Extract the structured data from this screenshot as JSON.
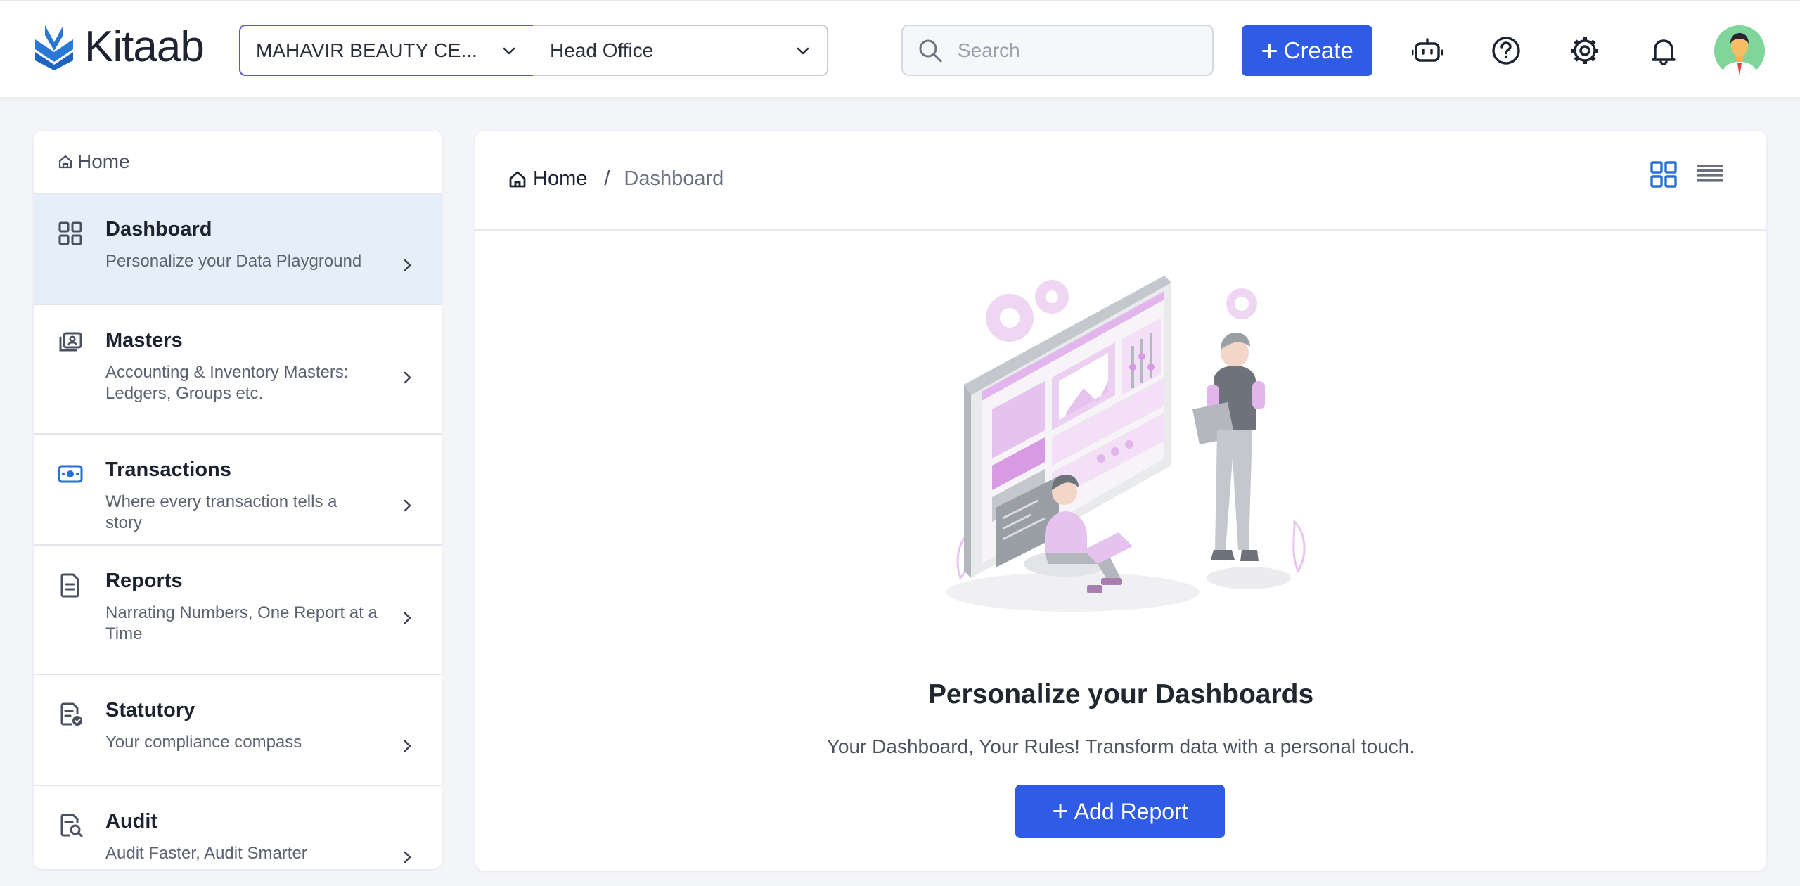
{
  "app": {
    "name": "Kitaab"
  },
  "header": {
    "company": "MAHAVIR BEAUTY CE...",
    "branch": "Head Office",
    "search_placeholder": "Search",
    "create_label": "Create",
    "icons": [
      "bot-icon",
      "help-icon",
      "gear-icon",
      "bell-icon"
    ]
  },
  "sidebar": {
    "home_label": "Home",
    "items": [
      {
        "title": "Dashboard",
        "desc": "Personalize your Data Playground",
        "icon": "grid-icon",
        "active": true
      },
      {
        "title": "Masters",
        "desc": "Accounting & Inventory Masters: Ledgers, Groups etc.",
        "icon": "masters-icon"
      },
      {
        "title": "Transactions",
        "desc": "Where every transaction tells a story",
        "icon": "transactions-icon"
      },
      {
        "title": "Reports",
        "desc": "Narrating Numbers, One Report at a Time",
        "icon": "report-icon"
      },
      {
        "title": "Statutory",
        "desc": "Your compliance compass",
        "icon": "statutory-icon"
      },
      {
        "title": "Audit",
        "desc": "Audit Faster, Audit Smarter",
        "icon": "audit-icon"
      }
    ]
  },
  "main": {
    "breadcrumb": {
      "home": "Home",
      "separator": "/",
      "current": "Dashboard"
    },
    "empty_state": {
      "title": "Personalize your Dashboards",
      "subtitle": "Your Dashboard, Your Rules! Transform data with a personal touch.",
      "button": "Add Report"
    }
  },
  "colors": {
    "primary": "#2f5be6",
    "active_bg": "#e6eef9",
    "accent_pink": "#e2b6ec",
    "grey": "#b4b8be"
  }
}
